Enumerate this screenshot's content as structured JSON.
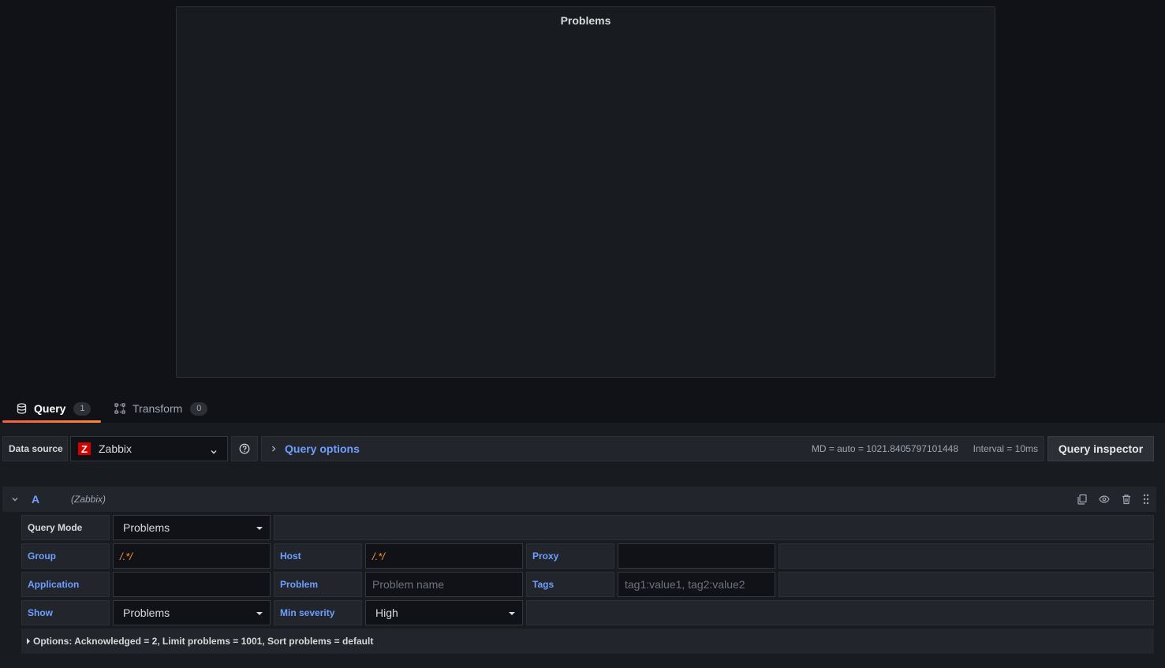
{
  "panel": {
    "title": "Problems"
  },
  "tabs": [
    {
      "label": "Query",
      "count": "1",
      "icon": "database-icon"
    },
    {
      "label": "Transform",
      "count": "0",
      "icon": "transform-icon"
    }
  ],
  "query_bar": {
    "datasource_label": "Data source",
    "datasource_value": "Zabbix",
    "datasource_logo": "Z",
    "query_options_label": "Query options",
    "md_text": "MD = auto = 1021.8405797101448",
    "interval_text": "Interval = 10ms",
    "inspector_label": "Query inspector"
  },
  "query": {
    "ref_id": "A",
    "datasource_name": "(Zabbix)",
    "fields": {
      "query_mode": {
        "label": "Query Mode",
        "value": "Problems"
      },
      "group": {
        "label": "Group",
        "value": "/.*/"
      },
      "host": {
        "label": "Host",
        "value": "/.*/"
      },
      "proxy": {
        "label": "Proxy",
        "value": ""
      },
      "application": {
        "label": "Application",
        "value": ""
      },
      "problem": {
        "label": "Problem",
        "placeholder": "Problem name"
      },
      "tags": {
        "label": "Tags",
        "placeholder": "tag1:value1, tag2:value2"
      },
      "show": {
        "label": "Show",
        "value": "Problems"
      },
      "min_severity": {
        "label": "Min severity",
        "value": "High"
      }
    },
    "options_text": "Options: Acknowledged = 2, Limit problems = 1001, Sort problems = default"
  },
  "colors": {
    "accent": "#6e9fff",
    "regex": "#ff9830",
    "tab_underline": "#f55f3e",
    "background": "#111217"
  }
}
